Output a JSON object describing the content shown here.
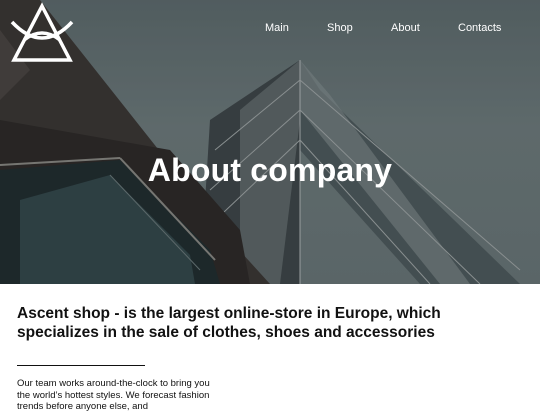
{
  "nav": {
    "items": [
      "Main",
      "Shop",
      "About",
      "Contacts"
    ]
  },
  "hero": {
    "title": "About company"
  },
  "content": {
    "headline": "Ascent shop - is the largest online-store in Europe, which specializes in the sale of clothes, shoes and accessories",
    "body": "Our team works around-the-clock to bring you the world’s hottest styles. We forecast fashion trends before anyone else, and"
  },
  "icons": {
    "logo": "triangle-eye-logo-icon"
  },
  "colors": {
    "hero_text": "#ffffff",
    "body_text": "#111111"
  }
}
